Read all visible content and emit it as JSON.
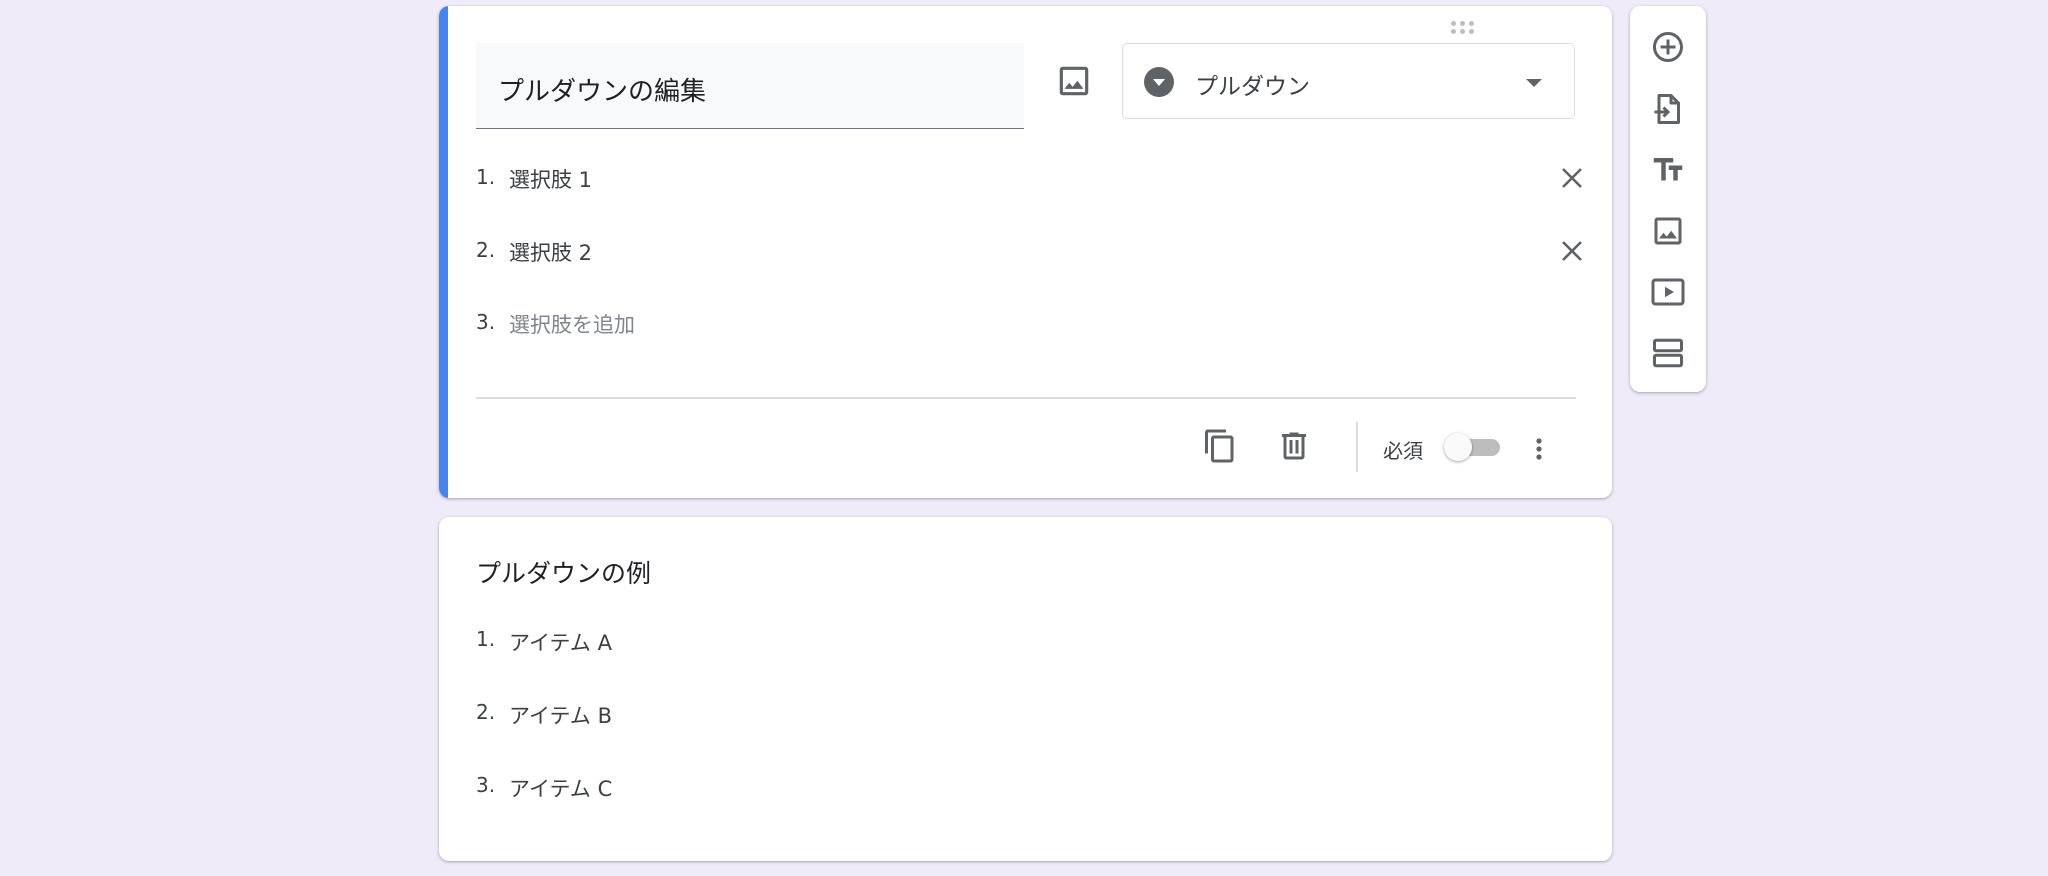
{
  "question": {
    "title": "プルダウンの編集",
    "type_label": "プルダウン",
    "options": [
      {
        "number": "1.",
        "label": "選択肢 1"
      },
      {
        "number": "2.",
        "label": "選択肢 2"
      }
    ],
    "add_option": {
      "number": "3.",
      "label": "選択肢を追加"
    },
    "required_label": "必須",
    "required": false
  },
  "example": {
    "title": "プルダウンの例",
    "items": [
      {
        "number": "1.",
        "label": "アイテム A"
      },
      {
        "number": "2.",
        "label": "アイテム B"
      },
      {
        "number": "3.",
        "label": "アイテム C"
      }
    ]
  },
  "side_toolbar": {
    "tools": [
      "add-question-icon",
      "import-questions-icon",
      "add-title-icon",
      "add-image-icon",
      "add-video-icon",
      "add-section-icon"
    ]
  },
  "colors": {
    "background": "#efebf8",
    "accent": "#4285f4",
    "icon": "#5f6368"
  }
}
